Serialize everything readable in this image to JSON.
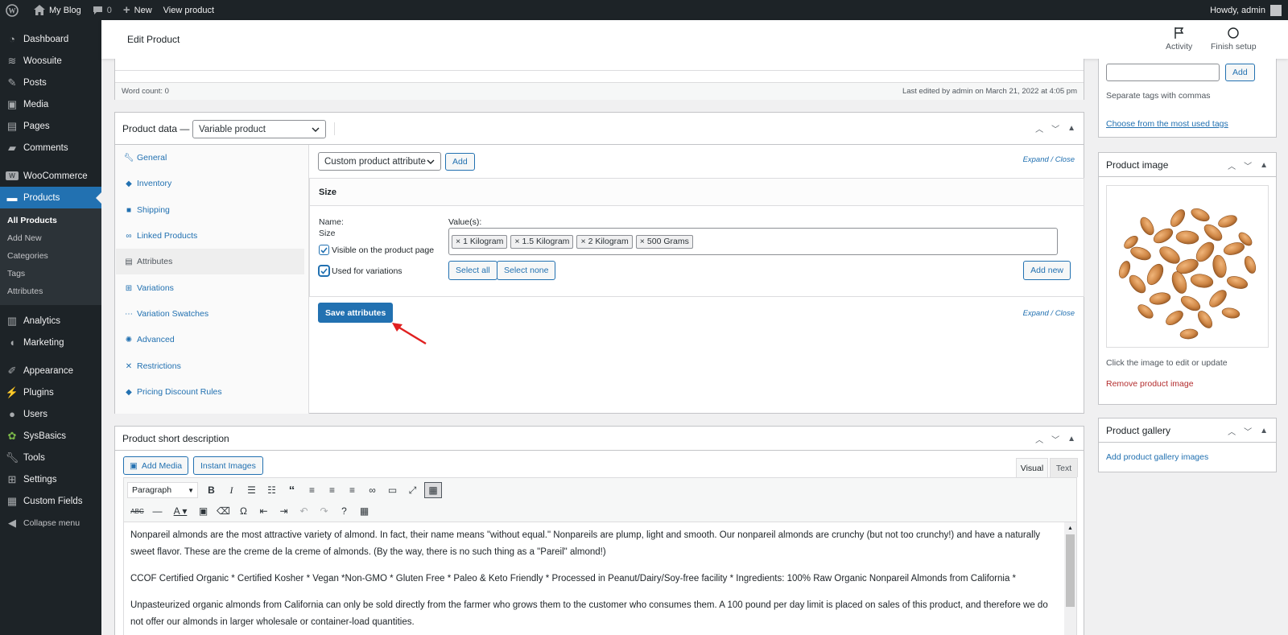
{
  "adminbar": {
    "site": "My Blog",
    "comments": "0",
    "new": "New",
    "view": "View product",
    "howdy": "Howdy, admin"
  },
  "sidebar": {
    "items": [
      {
        "label": "Dashboard"
      },
      {
        "label": "Woosuite"
      },
      {
        "label": "Posts"
      },
      {
        "label": "Media"
      },
      {
        "label": "Pages"
      },
      {
        "label": "Comments"
      },
      {
        "label": "WooCommerce"
      },
      {
        "label": "Products"
      }
    ],
    "submenu": [
      "All Products",
      "Add New",
      "Categories",
      "Tags",
      "Attributes"
    ],
    "items2": [
      {
        "label": "Analytics"
      },
      {
        "label": "Marketing"
      }
    ],
    "items3": [
      {
        "label": "Appearance"
      },
      {
        "label": "Plugins"
      },
      {
        "label": "Users"
      },
      {
        "label": "SysBasics"
      },
      {
        "label": "Tools"
      },
      {
        "label": "Settings"
      },
      {
        "label": "Custom Fields"
      },
      {
        "label": "Collapse menu"
      }
    ]
  },
  "topbar": {
    "title": "Edit Product",
    "activity": "Activity",
    "finish": "Finish setup"
  },
  "editor_footer": {
    "word_count": "Word count: 0",
    "last_edited": "Last edited by admin on March 21, 2022 at 4:05 pm"
  },
  "product_data": {
    "label": "Product data —",
    "type": "Variable product",
    "tabs": [
      "General",
      "Inventory",
      "Shipping",
      "Linked Products",
      "Attributes",
      "Variations",
      "Variation Swatches",
      "Advanced",
      "Restrictions",
      "Pricing Discount Rules"
    ],
    "attr_select": "Custom product attribute",
    "add": "Add",
    "expand_close": "Expand / Close",
    "attribute": {
      "title": "Size",
      "name_label": "Name:",
      "name_value": "Size",
      "values_label": "Value(s):",
      "values": [
        "1 Kilogram",
        "1.5 Kilogram",
        "2 Kilogram",
        "500 Grams"
      ],
      "visible": "Visible on the product page",
      "used_for_variations": "Used for variations",
      "select_all": "Select all",
      "select_none": "Select none",
      "add_new": "Add new"
    },
    "save": "Save attributes"
  },
  "short_desc": {
    "title": "Product short description",
    "add_media": "Add Media",
    "instant_images": "Instant Images",
    "visual": "Visual",
    "text": "Text",
    "format": "Paragraph",
    "p1": "Nonpareil almonds are the most attractive variety of almond. In fact, their name means \"without equal.\" Nonpareils are plump, light and smooth.  Our nonpareil almonds are crunchy (but not too crunchy!) and have a naturally sweet flavor. These are the creme de la creme of almonds. (By the way, there is no such thing as a \"Pareil\" almond!)",
    "p2": "CCOF Certified Organic * Certified Kosher * Vegan *Non-GMO * Gluten Free * Paleo & Keto Friendly * Processed in Peanut/Dairy/Soy-free facility * Ingredients: 100% Raw Organic Nonpareil Almonds from California *",
    "p3": "Unpasteurized organic almonds from California can only be sold directly from the farmer who grows them to the customer who consumes them. A 100 pound per day limit is placed on sales of this product, and therefore we do not offer our almonds in larger wholesale or container-load quantities."
  },
  "tags_box": {
    "add": "Add",
    "hint": "Separate tags with commas",
    "choose": "Choose from the most used tags"
  },
  "product_image": {
    "title": "Product image",
    "hint": "Click the image to edit or update",
    "remove": "Remove product image"
  },
  "gallery": {
    "title": "Product gallery",
    "add": "Add product gallery images"
  },
  "colors": {
    "accent": "#2271b1",
    "sidebar": "#1d2327",
    "danger": "#b32d2e",
    "arrow": "#e02020"
  }
}
